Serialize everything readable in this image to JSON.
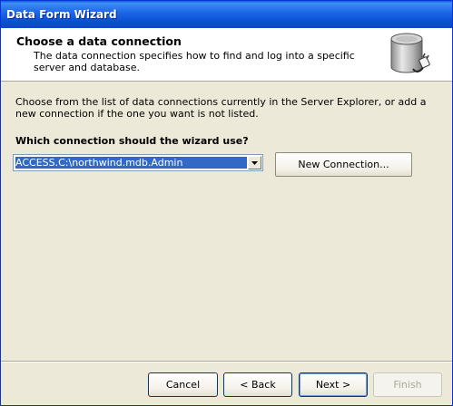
{
  "window": {
    "title": "Data Form Wizard"
  },
  "header": {
    "title": "Choose a data connection",
    "description": "The data connection specifies how to find and log into a specific server and database.",
    "icon": "database-connection-icon"
  },
  "body": {
    "instructions": "Choose from the list of data connections currently in the Server Explorer, or add a new connection if the one you want is not listed.",
    "question": "Which connection should the wizard use?",
    "connection_select": {
      "selected_value": "ACCESS.C:\\northwind.mdb.Admin"
    },
    "new_connection_label": "New Connection..."
  },
  "footer": {
    "cancel_label": "Cancel",
    "back_label": "< Back",
    "next_label": "Next >",
    "finish_label": "Finish"
  },
  "colors": {
    "titlebar": "#0a5fd8",
    "selection": "#316ac5",
    "dialog_background": "#ece9d8",
    "disabled_text": "#aca899"
  }
}
